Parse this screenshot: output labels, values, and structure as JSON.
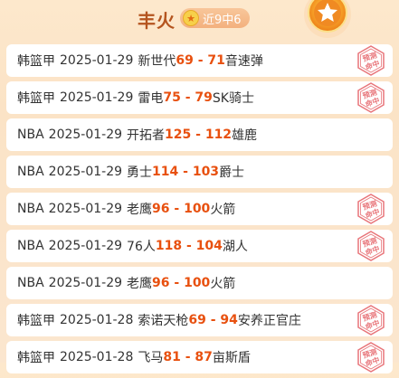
{
  "header": {
    "title": "丰火",
    "record": "近9中6",
    "star_glyph": "★"
  },
  "colors": {
    "accent": "#e8500f",
    "title": "#b4541e",
    "stamp": "#e8757a",
    "background": "#fbe3c6"
  },
  "stamp_text": {
    "line1": "预测",
    "line2": "命中"
  },
  "predictions": [
    {
      "league": "韩篮甲",
      "date": "2025-01-29",
      "home": "新世代",
      "home_score": "69",
      "sep": " - ",
      "away_score": "71",
      "away": "音速弹",
      "hit": true
    },
    {
      "league": "韩篮甲",
      "date": "2025-01-29",
      "home": "雷电",
      "home_score": "75",
      "sep": " - ",
      "away_score": "79",
      "away": "SK骑士",
      "hit": true
    },
    {
      "league": "NBA",
      "date": "2025-01-29",
      "home": "开拓者",
      "home_score": "125",
      "sep": " - ",
      "away_score": "112",
      "away": "雄鹿",
      "hit": false
    },
    {
      "league": "NBA",
      "date": "2025-01-29",
      "home": "勇士",
      "home_score": "114",
      "sep": " - ",
      "away_score": "103",
      "away": "爵士",
      "hit": false
    },
    {
      "league": "NBA",
      "date": "2025-01-29",
      "home": "老鹰",
      "home_score": "96",
      "sep": " - ",
      "away_score": "100",
      "away": "火箭",
      "hit": true
    },
    {
      "league": "NBA",
      "date": "2025-01-29",
      "home": "76人",
      "home_score": "118",
      "sep": " - ",
      "away_score": "104",
      "away": "湖人",
      "hit": true
    },
    {
      "league": "NBA",
      "date": "2025-01-29",
      "home": "老鹰",
      "home_score": "96",
      "sep": " - ",
      "away_score": "100",
      "away": "火箭",
      "hit": false
    },
    {
      "league": "韩篮甲",
      "date": "2025-01-28",
      "home": "索诺天枪",
      "home_score": "69",
      "sep": " - ",
      "away_score": "94",
      "away": "安养正官庄",
      "hit": true
    },
    {
      "league": "韩篮甲",
      "date": "2025-01-28",
      "home": "飞马",
      "home_score": "81",
      "sep": " - ",
      "away_score": "87",
      "away": "亩斯盾",
      "hit": true
    }
  ]
}
